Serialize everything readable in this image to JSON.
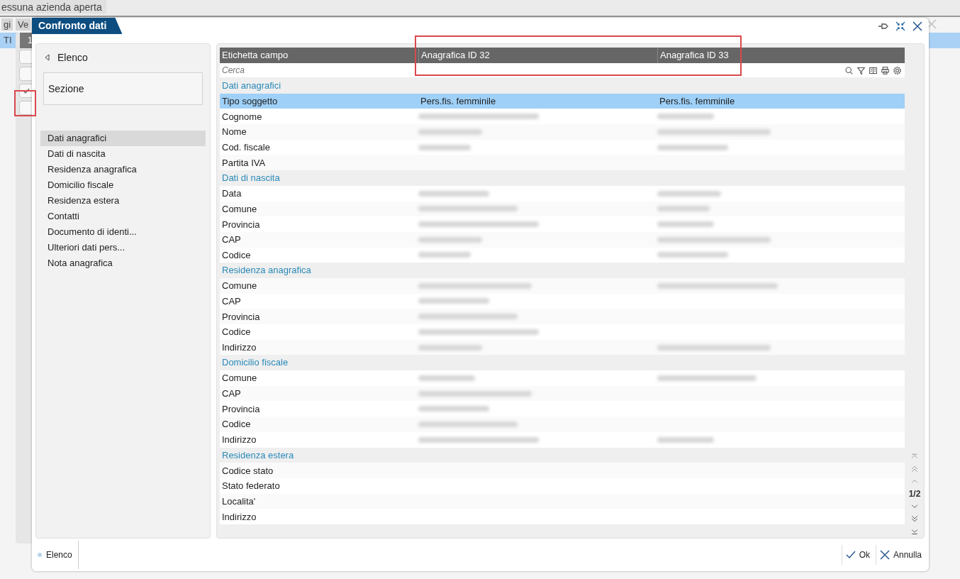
{
  "background": {
    "company_label": "essuna azienda aperta",
    "tabs": [
      "gi",
      "Ve"
    ],
    "row_label": "TI",
    "row_number": "1",
    "checkboxes": [
      {
        "checked": false
      },
      {
        "checked": false
      },
      {
        "checked": true
      },
      {
        "checked": false
      }
    ]
  },
  "window": {
    "title": "Confronto dati"
  },
  "sidebar": {
    "back_link": "Elenco",
    "section_label": "Sezione",
    "items": [
      {
        "label": "Dati anagrafici",
        "selected": true
      },
      {
        "label": "Dati di nascita",
        "selected": false
      },
      {
        "label": "Residenza anagrafica",
        "selected": false
      },
      {
        "label": "Domicilio fiscale",
        "selected": false
      },
      {
        "label": "Residenza estera",
        "selected": false
      },
      {
        "label": "Contatti",
        "selected": false
      },
      {
        "label": "Documento di identi...",
        "selected": false
      },
      {
        "label": "Ulteriori dati pers...",
        "selected": false
      },
      {
        "label": "Nota anagrafica",
        "selected": false
      }
    ]
  },
  "table": {
    "columns": [
      "Etichetta campo",
      "Anagrafica ID 32",
      "Anagrafica ID 33"
    ],
    "search": {
      "placeholder": "Cerca"
    },
    "rows": [
      {
        "kind": "section",
        "label": "Dati anagrafici"
      },
      {
        "kind": "field",
        "label": "Tipo soggetto",
        "selected": true,
        "cells": [
          {
            "kind": "text",
            "text": "Pers.fis. femminile"
          },
          {
            "kind": "text",
            "text": "Pers.fis. femminile"
          }
        ]
      },
      {
        "kind": "field",
        "label": "Cognome",
        "selected": false,
        "cells": [
          {
            "kind": "blurred"
          },
          {
            "kind": "blurred"
          }
        ]
      },
      {
        "kind": "field",
        "label": "Nome",
        "selected": false,
        "cells": [
          {
            "kind": "blurred"
          },
          {
            "kind": "blurred"
          }
        ]
      },
      {
        "kind": "field",
        "label": "Cod. fiscale",
        "selected": false,
        "cells": [
          {
            "kind": "blurred"
          },
          {
            "kind": "blurred"
          }
        ]
      },
      {
        "kind": "field",
        "label": "Partita IVA",
        "selected": false,
        "cells": [
          {
            "kind": "empty"
          },
          {
            "kind": "empty"
          }
        ]
      },
      {
        "kind": "section",
        "label": "Dati di nascita"
      },
      {
        "kind": "field",
        "label": "Data",
        "selected": false,
        "cells": [
          {
            "kind": "blurred"
          },
          {
            "kind": "blurred"
          }
        ]
      },
      {
        "kind": "field",
        "label": "Comune",
        "selected": false,
        "cells": [
          {
            "kind": "blurred"
          },
          {
            "kind": "blurred"
          }
        ]
      },
      {
        "kind": "field",
        "label": "Provincia",
        "selected": false,
        "cells": [
          {
            "kind": "blurred"
          },
          {
            "kind": "blurred"
          }
        ]
      },
      {
        "kind": "field",
        "label": "CAP",
        "selected": false,
        "cells": [
          {
            "kind": "blurred"
          },
          {
            "kind": "blurred"
          }
        ]
      },
      {
        "kind": "field",
        "label": "Codice",
        "selected": false,
        "cells": [
          {
            "kind": "blurred"
          },
          {
            "kind": "blurred"
          }
        ]
      },
      {
        "kind": "section",
        "label": "Residenza anagrafica"
      },
      {
        "kind": "field",
        "label": "Comune",
        "selected": false,
        "cells": [
          {
            "kind": "blurred"
          },
          {
            "kind": "blurred"
          }
        ]
      },
      {
        "kind": "field",
        "label": "CAP",
        "selected": false,
        "cells": [
          {
            "kind": "blurred"
          },
          {
            "kind": "empty"
          }
        ]
      },
      {
        "kind": "field",
        "label": "Provincia",
        "selected": false,
        "cells": [
          {
            "kind": "blurred"
          },
          {
            "kind": "empty"
          }
        ]
      },
      {
        "kind": "field",
        "label": "Codice",
        "selected": false,
        "cells": [
          {
            "kind": "blurred"
          },
          {
            "kind": "empty"
          }
        ]
      },
      {
        "kind": "field",
        "label": "Indirizzo",
        "selected": false,
        "cells": [
          {
            "kind": "blurred"
          },
          {
            "kind": "blurred"
          }
        ]
      },
      {
        "kind": "section",
        "label": "Domicilio fiscale"
      },
      {
        "kind": "field",
        "label": "Comune",
        "selected": false,
        "cells": [
          {
            "kind": "blurred"
          },
          {
            "kind": "blurred"
          }
        ]
      },
      {
        "kind": "field",
        "label": "CAP",
        "selected": false,
        "cells": [
          {
            "kind": "blurred"
          },
          {
            "kind": "empty"
          }
        ]
      },
      {
        "kind": "field",
        "label": "Provincia",
        "selected": false,
        "cells": [
          {
            "kind": "blurred"
          },
          {
            "kind": "empty"
          }
        ]
      },
      {
        "kind": "field",
        "label": "Codice",
        "selected": false,
        "cells": [
          {
            "kind": "blurred"
          },
          {
            "kind": "empty"
          }
        ]
      },
      {
        "kind": "field",
        "label": "Indirizzo",
        "selected": false,
        "cells": [
          {
            "kind": "blurred"
          },
          {
            "kind": "blurred"
          }
        ]
      },
      {
        "kind": "section",
        "label": "Residenza estera"
      },
      {
        "kind": "field",
        "label": "Codice stato",
        "selected": false,
        "cells": [
          {
            "kind": "empty"
          },
          {
            "kind": "empty"
          }
        ]
      },
      {
        "kind": "field",
        "label": "Stato federato",
        "selected": false,
        "cells": [
          {
            "kind": "empty"
          },
          {
            "kind": "empty"
          }
        ]
      },
      {
        "kind": "field",
        "label": "Localita'",
        "selected": false,
        "cells": [
          {
            "kind": "empty"
          },
          {
            "kind": "empty"
          }
        ]
      },
      {
        "kind": "field",
        "label": "Indirizzo",
        "selected": false,
        "cells": [
          {
            "kind": "empty"
          },
          {
            "kind": "empty"
          }
        ]
      }
    ]
  },
  "pager": {
    "page": "1/2"
  },
  "footer": {
    "tab": "Elenco",
    "ok": "Ok",
    "cancel": "Annulla"
  }
}
